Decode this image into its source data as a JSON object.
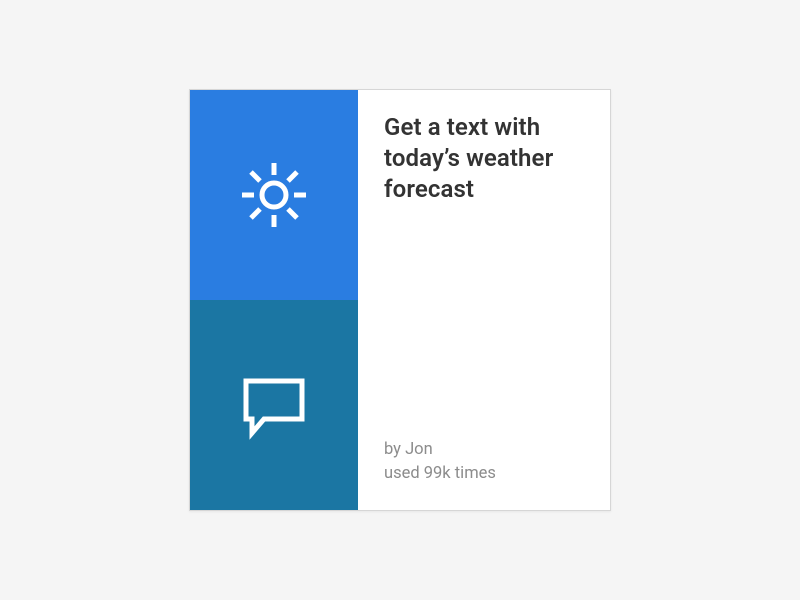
{
  "card": {
    "title": "Get a text with today’s weather forecast",
    "author_prefix": "by ",
    "author": "Jon",
    "usage_prefix": "used ",
    "usage_count": "99k",
    "usage_suffix": " times",
    "colors": {
      "trigger_tile": "#2a7de1",
      "action_tile": "#1b76a3"
    },
    "icons": {
      "trigger": "sun-icon",
      "action": "chat-bubble-icon"
    }
  }
}
